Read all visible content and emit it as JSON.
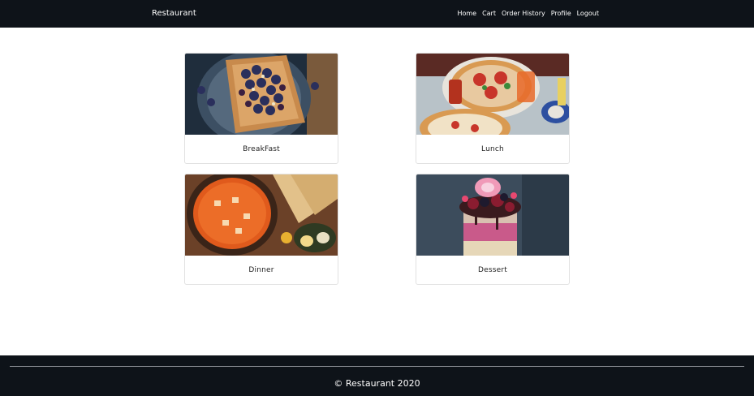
{
  "navbar": {
    "brand": "Restaurant",
    "links": [
      "Home",
      "Cart",
      "Order History",
      "Profile",
      "Logout"
    ]
  },
  "menu": {
    "categories": [
      {
        "label": "BreakFast",
        "image": "breakfast-waffle-photo"
      },
      {
        "label": "Lunch",
        "image": "lunch-pizza-photo"
      },
      {
        "label": "Dinner",
        "image": "dinner-curry-photo"
      },
      {
        "label": "Dessert",
        "image": "dessert-freakshake-photo"
      }
    ]
  },
  "footer": {
    "text": "© Restaurant 2020"
  },
  "colors": {
    "navbar_bg": "#0e1319",
    "footer_bg": "#0e1319",
    "page_bg": "#ffffff"
  }
}
